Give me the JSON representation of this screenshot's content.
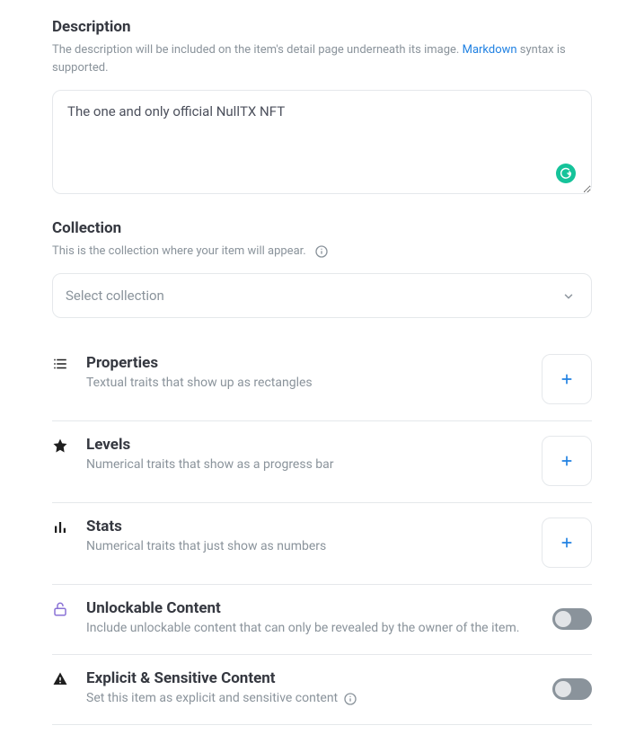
{
  "description": {
    "title": "Description",
    "help_pre": "The description will be included on the item's detail page underneath its image. ",
    "help_link": "Markdown",
    "help_post": " syntax is supported.",
    "value": "The one and only official NullTX NFT"
  },
  "collection": {
    "title": "Collection",
    "help": "This is the collection where your item will appear.",
    "placeholder": "Select collection"
  },
  "traits": {
    "properties": {
      "title": "Properties",
      "desc": "Textual traits that show up as rectangles"
    },
    "levels": {
      "title": "Levels",
      "desc": "Numerical traits that show as a progress bar"
    },
    "stats": {
      "title": "Stats",
      "desc": "Numerical traits that just show as numbers"
    },
    "unlockable": {
      "title": "Unlockable Content",
      "desc": "Include unlockable content that can only be revealed by the owner of the item."
    },
    "explicit": {
      "title": "Explicit & Sensitive Content",
      "desc": "Set this item as explicit and sensitive content"
    }
  }
}
